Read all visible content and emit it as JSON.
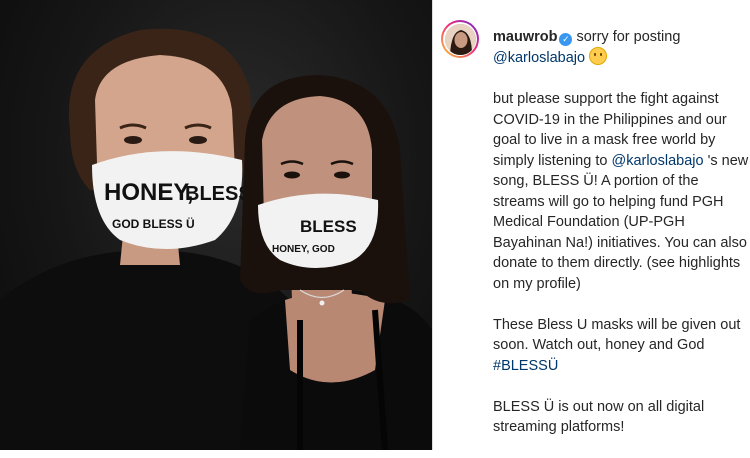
{
  "post": {
    "username": "mauwrob",
    "verified": true,
    "caption_intro": "sorry for posting",
    "mention": "@karloslabajo",
    "emoji": "upside-down-face-emoji",
    "paragraph1_a": "but please support the fight against COVID-19 in the Philippines and our goal to live in a mask free world by simply listening to",
    "paragraph1_mention": "@karloslabajo",
    "paragraph1_b": "'s new song, BLESS Ü! A portion of the streams will go to helping fund PGH Medical Foundation (UP-PGH Bayahinan Na!) initiatives. You can also donate to them directly. (see highlights on my profile)",
    "paragraph2": "These Bless U masks will be given out soon. Watch out, honey and God",
    "hashtag": "#BLESSÜ",
    "paragraph3": "BLESS Ü is out now on all digital streaming platforms!"
  },
  "photo": {
    "mask_text_left_1": "HONEY,",
    "mask_text_left_2": "BLESS",
    "mask_text_left_3": "GOD BLESS Ü",
    "mask_text_right_1": "BLESS",
    "mask_text_right_2": "HONEY, GOD"
  },
  "colors": {
    "link": "#00376b",
    "verified_badge": "#3897f0",
    "text": "#262626",
    "divider": "#dbdbdb"
  }
}
